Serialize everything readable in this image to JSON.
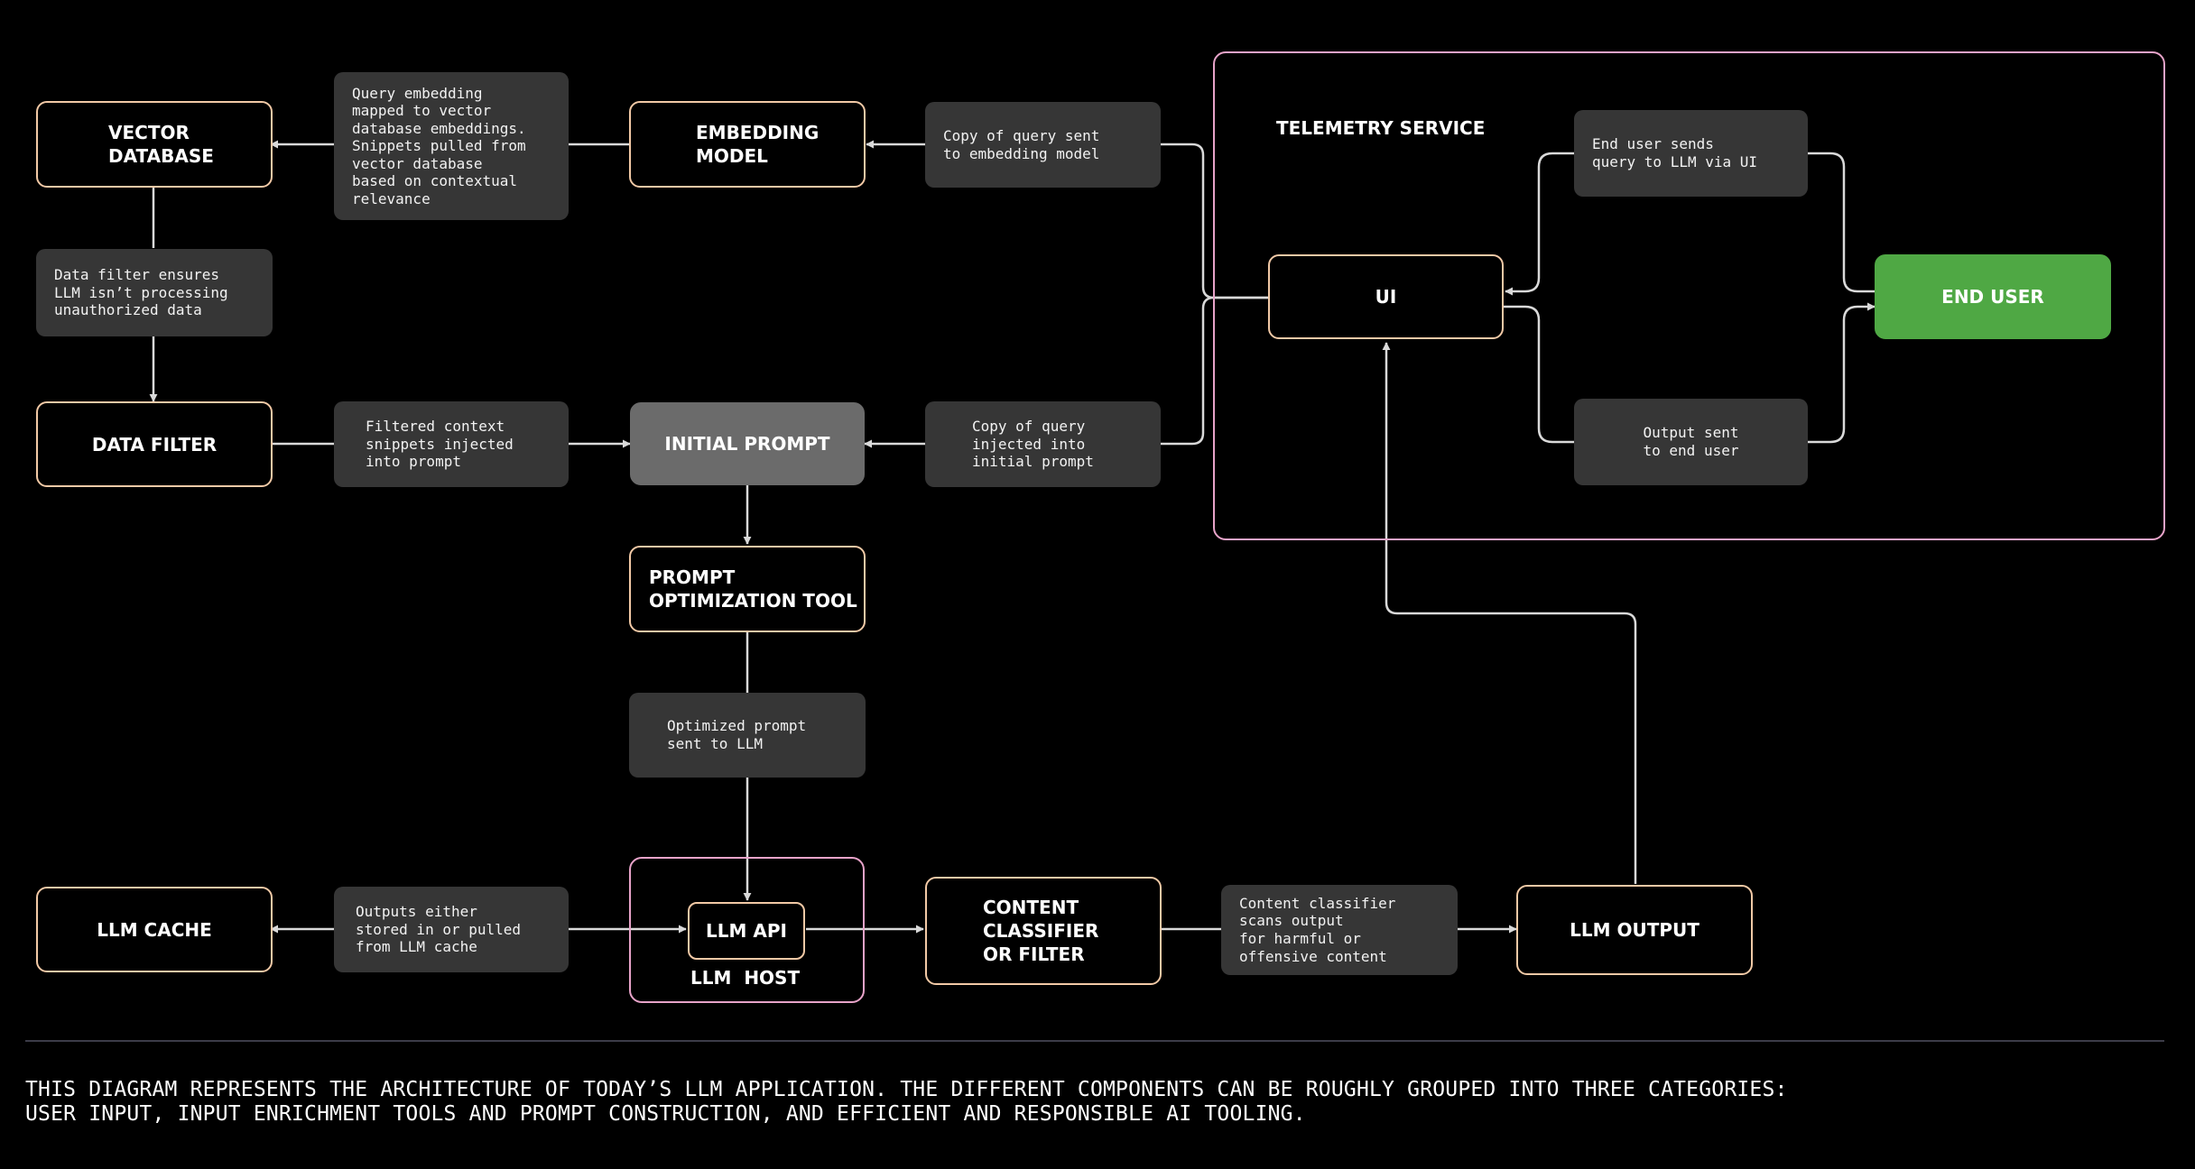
{
  "nodes": {
    "vector_database": "VECTOR\nDATABASE",
    "embedding_model": "EMBEDDING\nMODEL",
    "data_filter": "DATA FILTER",
    "initial_prompt": "INITIAL PROMPT",
    "prompt_optimization_tool": "PROMPT\nOPTIMIZATION TOOL",
    "llm_cache": "LLM CACHE",
    "llm_api": "LLM API",
    "content_classifier": "CONTENT\nCLASSIFIER\nOR FILTER",
    "llm_output": "LLM OUTPUT",
    "ui": "UI",
    "end_user": "END USER"
  },
  "groups": {
    "telemetry_service": "TELEMETRY SERVICE",
    "llm_host": "LLM  HOST"
  },
  "edge_labels": {
    "query_embedding": "Query embedding\nmapped to vector\ndatabase embeddings.\nSnippets pulled from\nvector database\nbased on contextual\nrelevance",
    "copy_to_embedding": "Copy of query sent\nto embedding model",
    "data_filter_note": "Data filter ensures\nLLM isn’t processing\nunauthorized data",
    "filtered_context": "Filtered context\nsnippets injected\ninto prompt",
    "copy_to_prompt": "Copy of query\ninjected into\ninitial prompt",
    "optimized_prompt": "Optimized prompt\nsent to LLM",
    "cache_note": "Outputs either\nstored in or pulled\nfrom LLM cache",
    "classifier_note": "Content classifier\nscans output\nfor harmful or\noffensive content",
    "end_user_sends": "End user sends\nquery to LLM via UI",
    "output_sent": "Output sent\nto end user"
  },
  "caption": {
    "line1": "THIS DIAGRAM REPRESENTS THE ARCHITECTURE OF TODAY’S LLM APPLICATION. THE DIFFERENT COMPONENTS CAN BE ROUGHLY GROUPED INTO THREE CATEGORIES:",
    "line2": "USER INPUT, INPUT ENRICHMENT TOOLS AND PROMPT CONSTRUCTION, AND EFFICIENT AND RESPONSIBLE AI TOOLING."
  },
  "colors": {
    "background": "#000000",
    "node_border": "#f2c9a6",
    "group_border": "#e7a3c9",
    "label_fill": "#363636",
    "initial_prompt_fill": "#6b6b6b",
    "end_user_fill": "#4fa844",
    "connector": "#d9d9d9"
  }
}
